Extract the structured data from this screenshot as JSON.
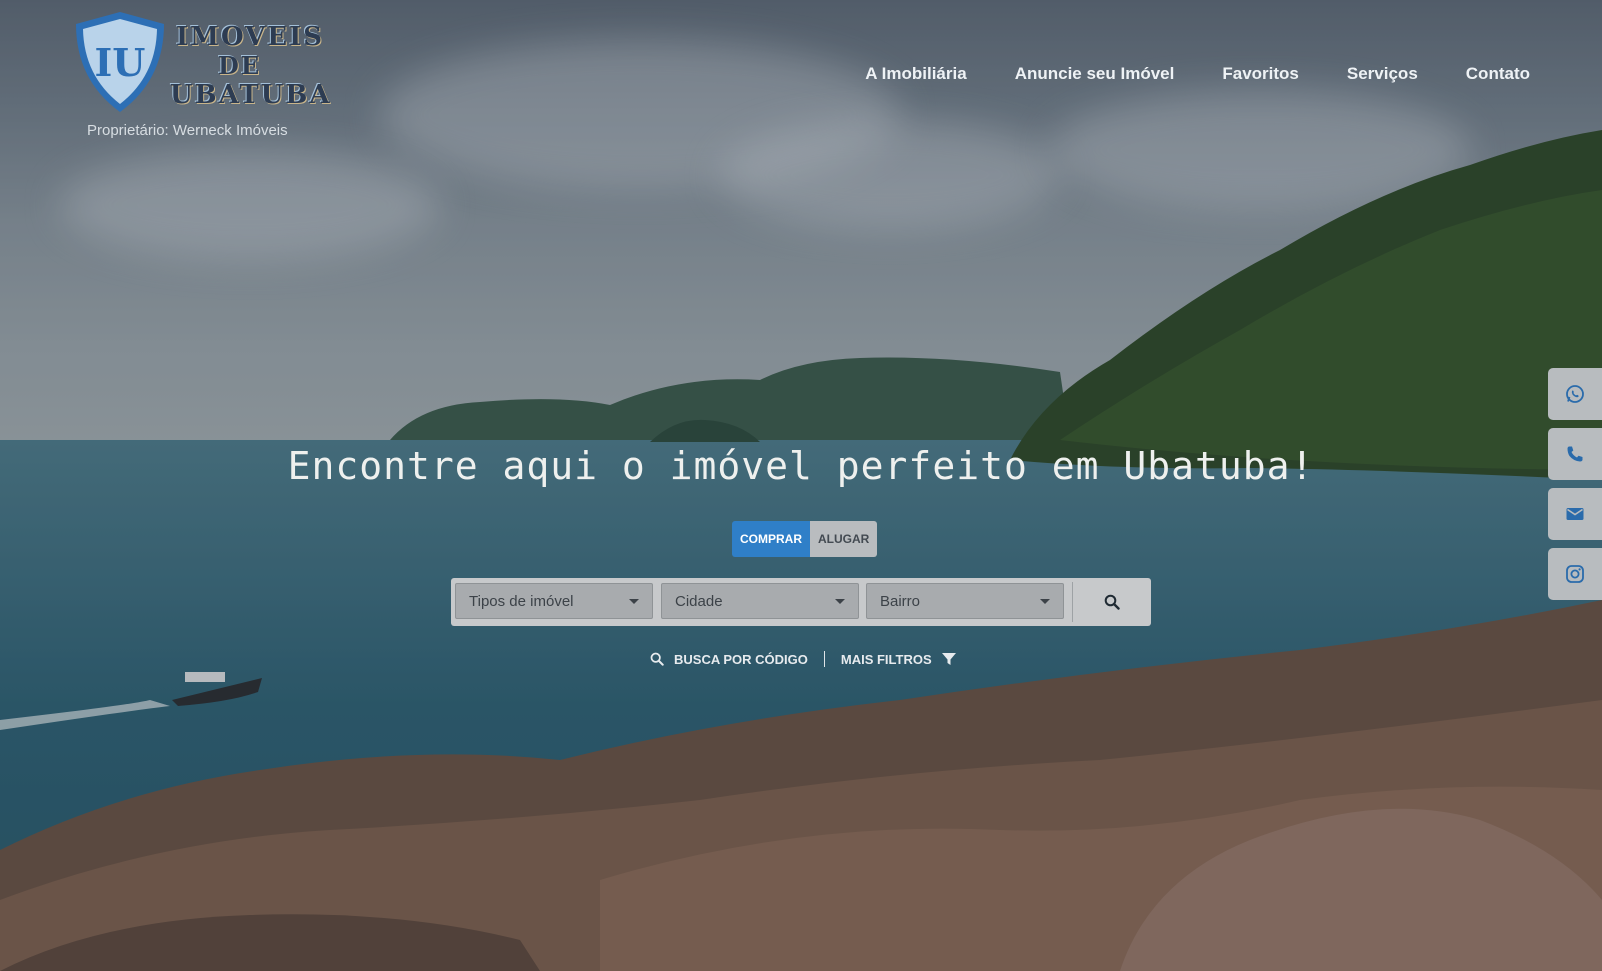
{
  "brand": {
    "logo_line1": "IMOVEIS",
    "logo_line2": "DE",
    "logo_line3": "UBATUBA",
    "owner": "Proprietário: Werneck Imóveis"
  },
  "nav": {
    "items": [
      {
        "label": "A Imobiliária"
      },
      {
        "label": "Anuncie seu Imóvel"
      },
      {
        "label": "Favoritos"
      },
      {
        "label": "Serviços"
      },
      {
        "label": "Contato"
      }
    ]
  },
  "hero": {
    "title": "Encontre aqui o imóvel perfeito em Ubatuba!"
  },
  "mode": {
    "buy_label": "COMPRAR",
    "rent_label": "ALUGAR",
    "selected": "COMPRAR"
  },
  "search": {
    "type_placeholder": "Tipos de imóvel",
    "city_placeholder": "Cidade",
    "neighborhood_placeholder": "Bairro",
    "button_icon": "search-icon"
  },
  "links": {
    "code_search": "BUSCA POR CÓDIGO",
    "more_filters": "MAIS FILTROS"
  },
  "contact_bar": {
    "icons": [
      "whatsapp-icon",
      "phone-icon",
      "email-icon",
      "instagram-icon"
    ]
  },
  "colors": {
    "accent": "#2f7fc8",
    "nav_text": "#eef2f5",
    "logo_text": "#2d3c52"
  }
}
